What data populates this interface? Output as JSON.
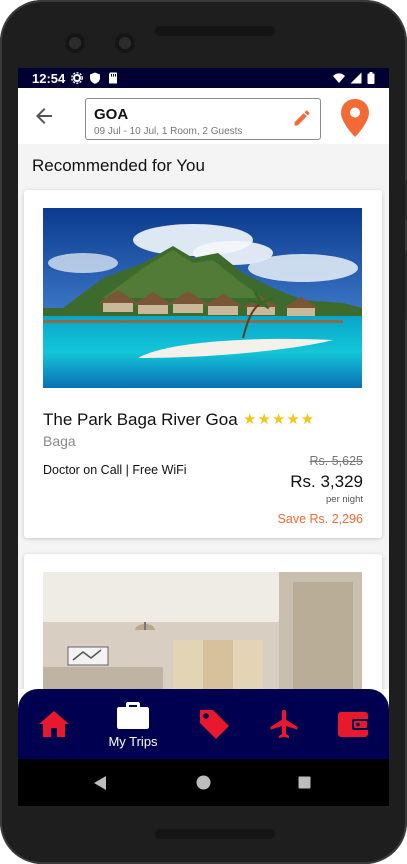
{
  "status_bar": {
    "time": "12:54"
  },
  "search": {
    "city": "GOA",
    "details": "09 Jul - 10 Jul, 1 Room, 2 Guests"
  },
  "section_title": "Recommended for You",
  "hotels": [
    {
      "name": "The Park Baga River Goa",
      "rating_stars": 5,
      "stars_display": "★★★★★",
      "locality": "Baga",
      "amenities": "Doctor on Call | Free WiFi",
      "original_price": "Rs. 5,625",
      "price": "Rs. 3,329",
      "price_unit": "per night",
      "savings": "Save Rs. 2,296"
    }
  ],
  "bottom_nav": {
    "items": [
      {
        "icon": "home-icon",
        "label": ""
      },
      {
        "icon": "briefcase-icon",
        "label": "My Trips"
      },
      {
        "icon": "tag-icon",
        "label": ""
      },
      {
        "icon": "flight-icon",
        "label": ""
      },
      {
        "icon": "wallet-icon",
        "label": ""
      }
    ]
  },
  "colors": {
    "accent": "#f26a35",
    "nav_bg": "#000050",
    "nav_icon": "#e8192c",
    "stars": "#f5c518"
  }
}
